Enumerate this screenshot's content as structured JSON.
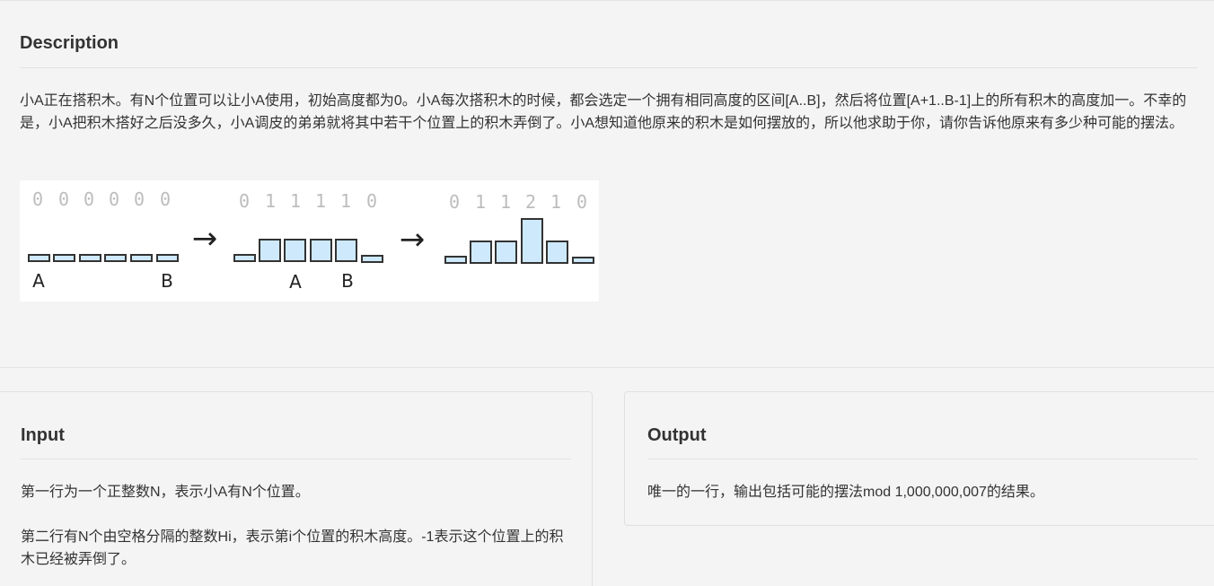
{
  "description": {
    "title": "Description",
    "text": "小A正在搭积木。有N个位置可以让小A使用，初始高度都为0。小A每次搭积木的时候，都会选定一个拥有相同高度的区间[A..B]，然后将位置[A+1..B-1]上的所有积木的高度加一。不幸的是，小A把积木搭好之后没多久，小A调皮的弟弟就将其中若干个位置上的积木弄倒了。小A想知道他原来的积木是如何摆放的，所以他求助于你，请你告诉他原来有多少种可能的摆法。",
    "figure": {
      "stage1_heights": [
        "0",
        "0",
        "0",
        "0",
        "0",
        "0"
      ],
      "stage1_markers": [
        "A",
        "B"
      ],
      "stage2_heights": [
        "0",
        "1",
        "1",
        "1",
        "1",
        "0"
      ],
      "stage2_markers": [
        "A",
        "B"
      ],
      "stage3_heights": [
        "0",
        "1",
        "1",
        "2",
        "1",
        "0"
      ],
      "arrow": "→",
      "bar_fill": "#cde9fb",
      "bar_stroke": "#333333",
      "number_color": "#bdbdbd"
    }
  },
  "input": {
    "title": "Input",
    "line1": "第一行为一个正整数N，表示小A有N个位置。",
    "line2": "第二行有N个由空格分隔的整数Hi，表示第i个位置的积木高度。-1表示这个位置上的积木已经被弄倒了。"
  },
  "output": {
    "title": "Output",
    "line1": "唯一的一行，输出包括可能的摆法mod 1,000,000,007的结果。"
  }
}
